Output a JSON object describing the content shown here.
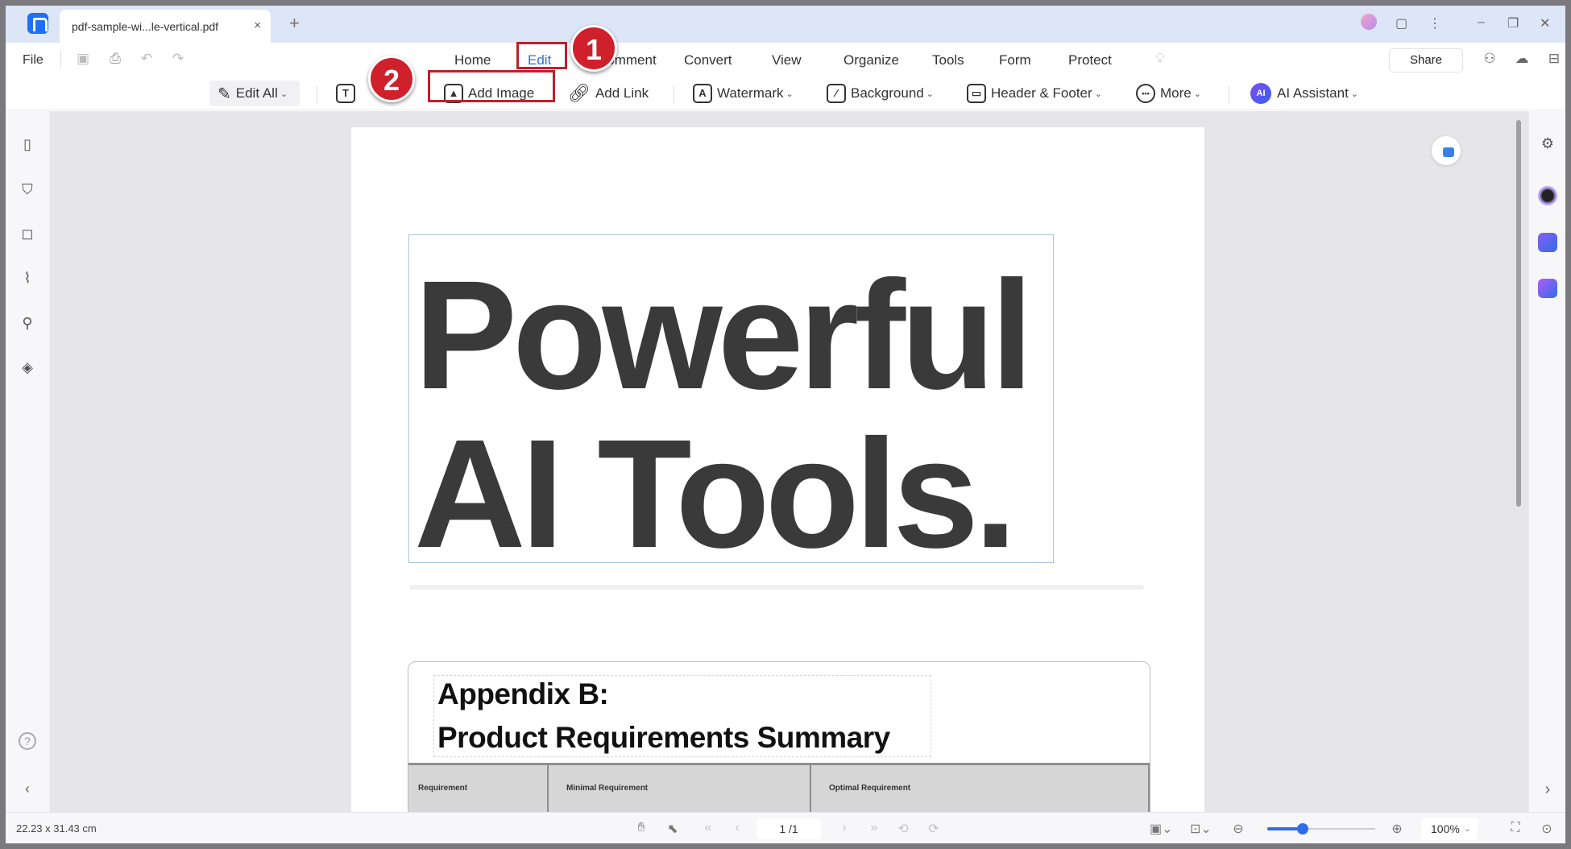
{
  "titlebar": {
    "tab_title": "pdf-sample-wi...le-vertical.pdf",
    "tab_close": "×",
    "new_tab": "+",
    "controls": {
      "feedback": "▢",
      "more": "⋮",
      "minimize": "–",
      "restore": "❐",
      "close": "✕"
    }
  },
  "menubar": {
    "file_label": "File",
    "tabs": [
      {
        "label": "Home"
      },
      {
        "label": "Edit",
        "active": true
      },
      {
        "label": "Comment"
      },
      {
        "label": "Convert"
      },
      {
        "label": "View"
      },
      {
        "label": "Organize"
      },
      {
        "label": "Tools"
      },
      {
        "label": "Form"
      },
      {
        "label": "Protect"
      }
    ],
    "share_label": "Share"
  },
  "ribbon": {
    "edit_all": "Edit All",
    "add_text_icon": "T",
    "add_image": "Add Image",
    "add_link": "Add Link",
    "watermark": "Watermark",
    "watermark_icon": "A",
    "background": "Background",
    "header_footer": "Header & Footer",
    "more": "More",
    "more_icon": "•••",
    "ai_badge": "AI",
    "ai_assistant": "AI Assistant",
    "caret": "⌄"
  },
  "annotations": {
    "step1": "1",
    "step2": "2",
    "highlight_color": "#c21e2a"
  },
  "document": {
    "hero_line1": "Powerful",
    "hero_line2": "AI Tools.",
    "appendix_line1": "Appendix B:",
    "appendix_line2": "Product Requirements Summary",
    "table_headers": [
      "Requirement",
      "Minimal Requirement",
      "Optimal Requirement"
    ]
  },
  "statusbar": {
    "dimensions": "22.23 x 31.43 cm",
    "page_indicator": "1 /1",
    "zoom_level": "100%",
    "zoom_slider_fraction": 0.33
  },
  "colors": {
    "accent": "#2f6ee6",
    "highlight": "#c21e2a"
  }
}
